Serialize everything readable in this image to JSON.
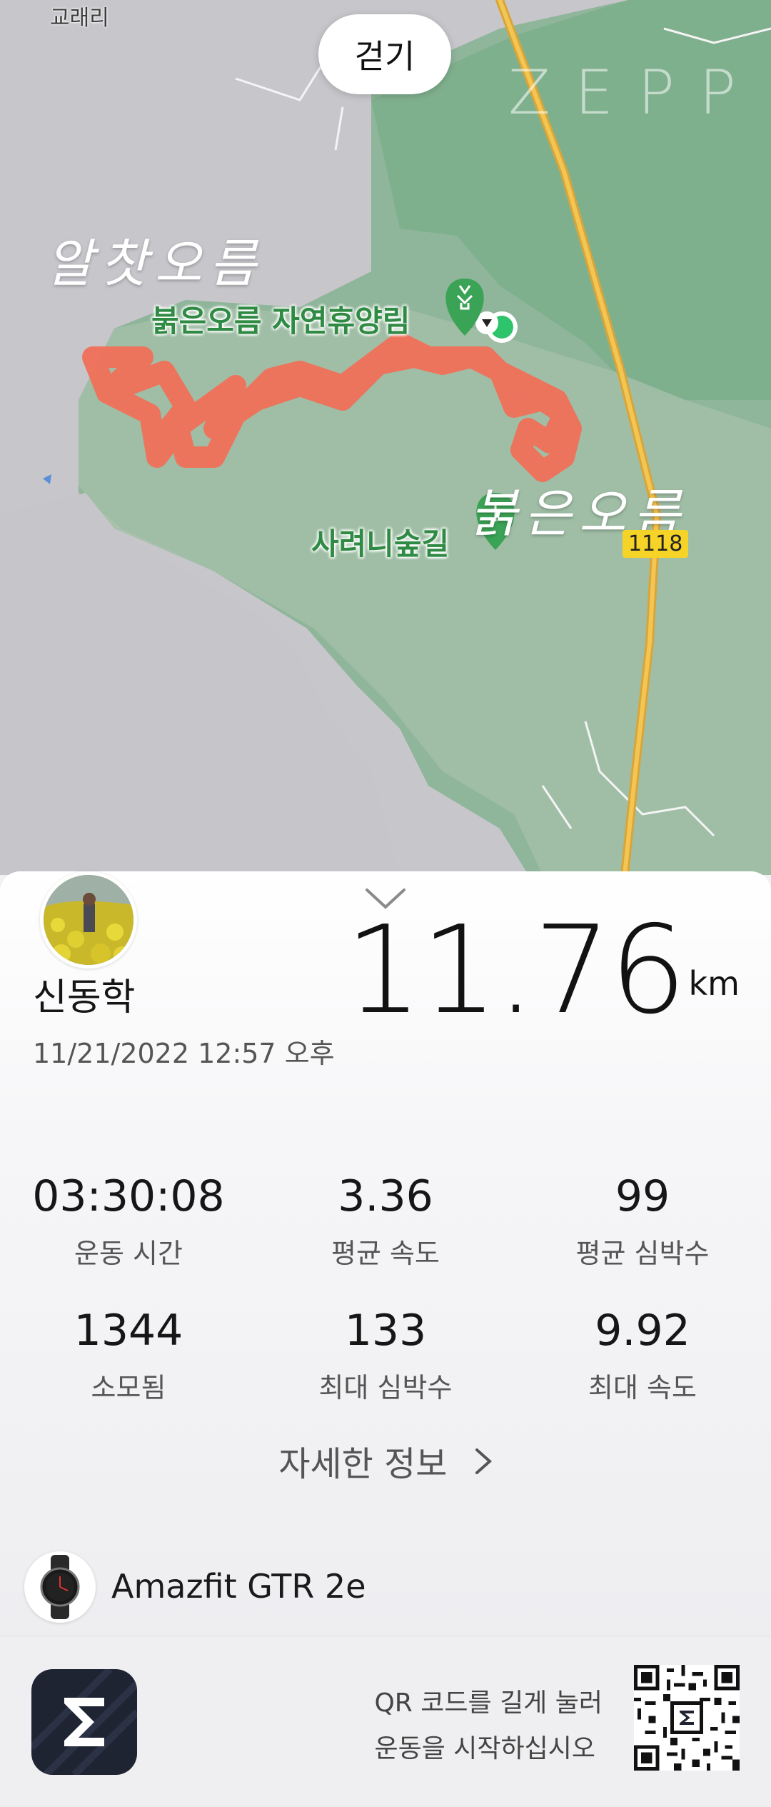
{
  "map": {
    "mode_label": "걷기",
    "watermark": "ZEPP",
    "place_top_left": "교래리",
    "poi_forest": "붉은오름 자연휴양림",
    "poi_trail": "사려니숲길",
    "annotation_left": "알찻오름",
    "annotation_right": "붉은오름",
    "road_number": "1118",
    "route_color": "#f07058",
    "forest_color": "#82b28e"
  },
  "activity": {
    "user_name": "신동학",
    "datetime": "11/21/2022 12:57 오후",
    "distance": "11.76",
    "distance_unit": "km",
    "stats": [
      {
        "value": "03:30:08",
        "label": "운동 시간"
      },
      {
        "value": "3.36",
        "label": "평균 속도"
      },
      {
        "value": "99",
        "label": "평균 심박수"
      },
      {
        "value": "1344",
        "label": "소모됨"
      },
      {
        "value": "133",
        "label": "최대 심박수"
      },
      {
        "value": "9.92",
        "label": "최대 속도"
      }
    ],
    "detail_link": "자세한 정보",
    "device_name": "Amazfit GTR 2e"
  },
  "footer": {
    "qr_line1": "QR 코드를 길게 눌러",
    "qr_line2": "운동을 시작하십시오"
  }
}
